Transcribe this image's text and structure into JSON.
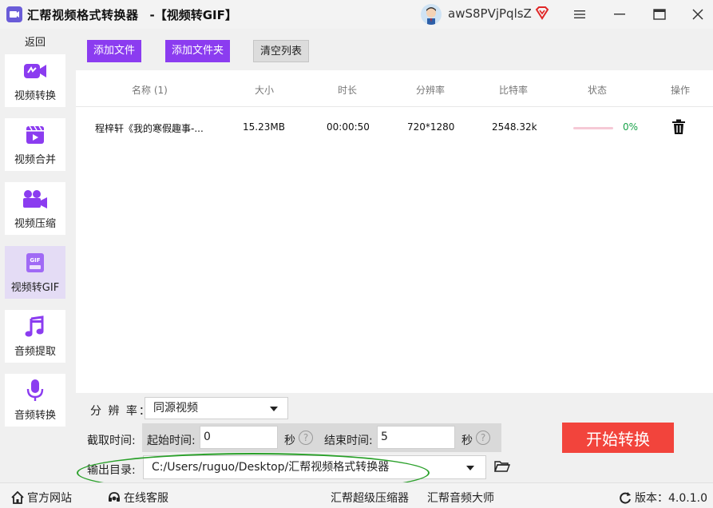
{
  "window": {
    "app_title": "汇帮视频格式转换器",
    "subtitle": "-【视频转GIF】",
    "user_name": "awS8PVjPqlsZ"
  },
  "sidebar": {
    "back_label": "返回",
    "items": [
      {
        "label": "视频转换",
        "icon": "video-convert-icon"
      },
      {
        "label": "视频合并",
        "icon": "video-merge-icon"
      },
      {
        "label": "视频压缩",
        "icon": "video-compress-icon"
      },
      {
        "label": "视频转GIF",
        "icon": "gif-icon",
        "active": true
      },
      {
        "label": "音频提取",
        "icon": "music-note-icon"
      },
      {
        "label": "音频转换",
        "icon": "microphone-icon"
      }
    ]
  },
  "toolbar": {
    "add_file": "添加文件",
    "add_folder": "添加文件夹",
    "clear_list": "清空列表"
  },
  "table": {
    "headers": [
      "名称 (1)",
      "大小",
      "时长",
      "分辨率",
      "比特率",
      "状态",
      "操作"
    ],
    "rows": [
      {
        "name": "程梓轩《我的寒假趣事-...",
        "size": "15.23MB",
        "duration": "00:00:50",
        "resolution": "720*1280",
        "bitrate": "2548.32k",
        "progress": "0%"
      }
    ]
  },
  "settings": {
    "resolution_label": "分 辨 率：",
    "resolution_value": "同源视频",
    "clip_label": "截取时间:",
    "start_label": "起始时间:",
    "start_value": "0",
    "end_label": "结束时间:",
    "end_value": "5",
    "unit": "秒",
    "help": "?",
    "output_label": "输出目录:",
    "output_path": "C:/Users/ruguo/Desktop/汇帮视频格式转换器",
    "start_button": "开始转换"
  },
  "statusbar": {
    "website": "官方网站",
    "support": "在线客服",
    "compressor": "汇帮超级压缩器",
    "audio_master": "汇帮音频大师",
    "version": "版本：4.0.1.0"
  },
  "colors": {
    "accent": "#8b3cf0",
    "start_button": "#f2443c",
    "progress_text": "#1aa34a",
    "highlight_ellipse": "#2aa02a"
  }
}
